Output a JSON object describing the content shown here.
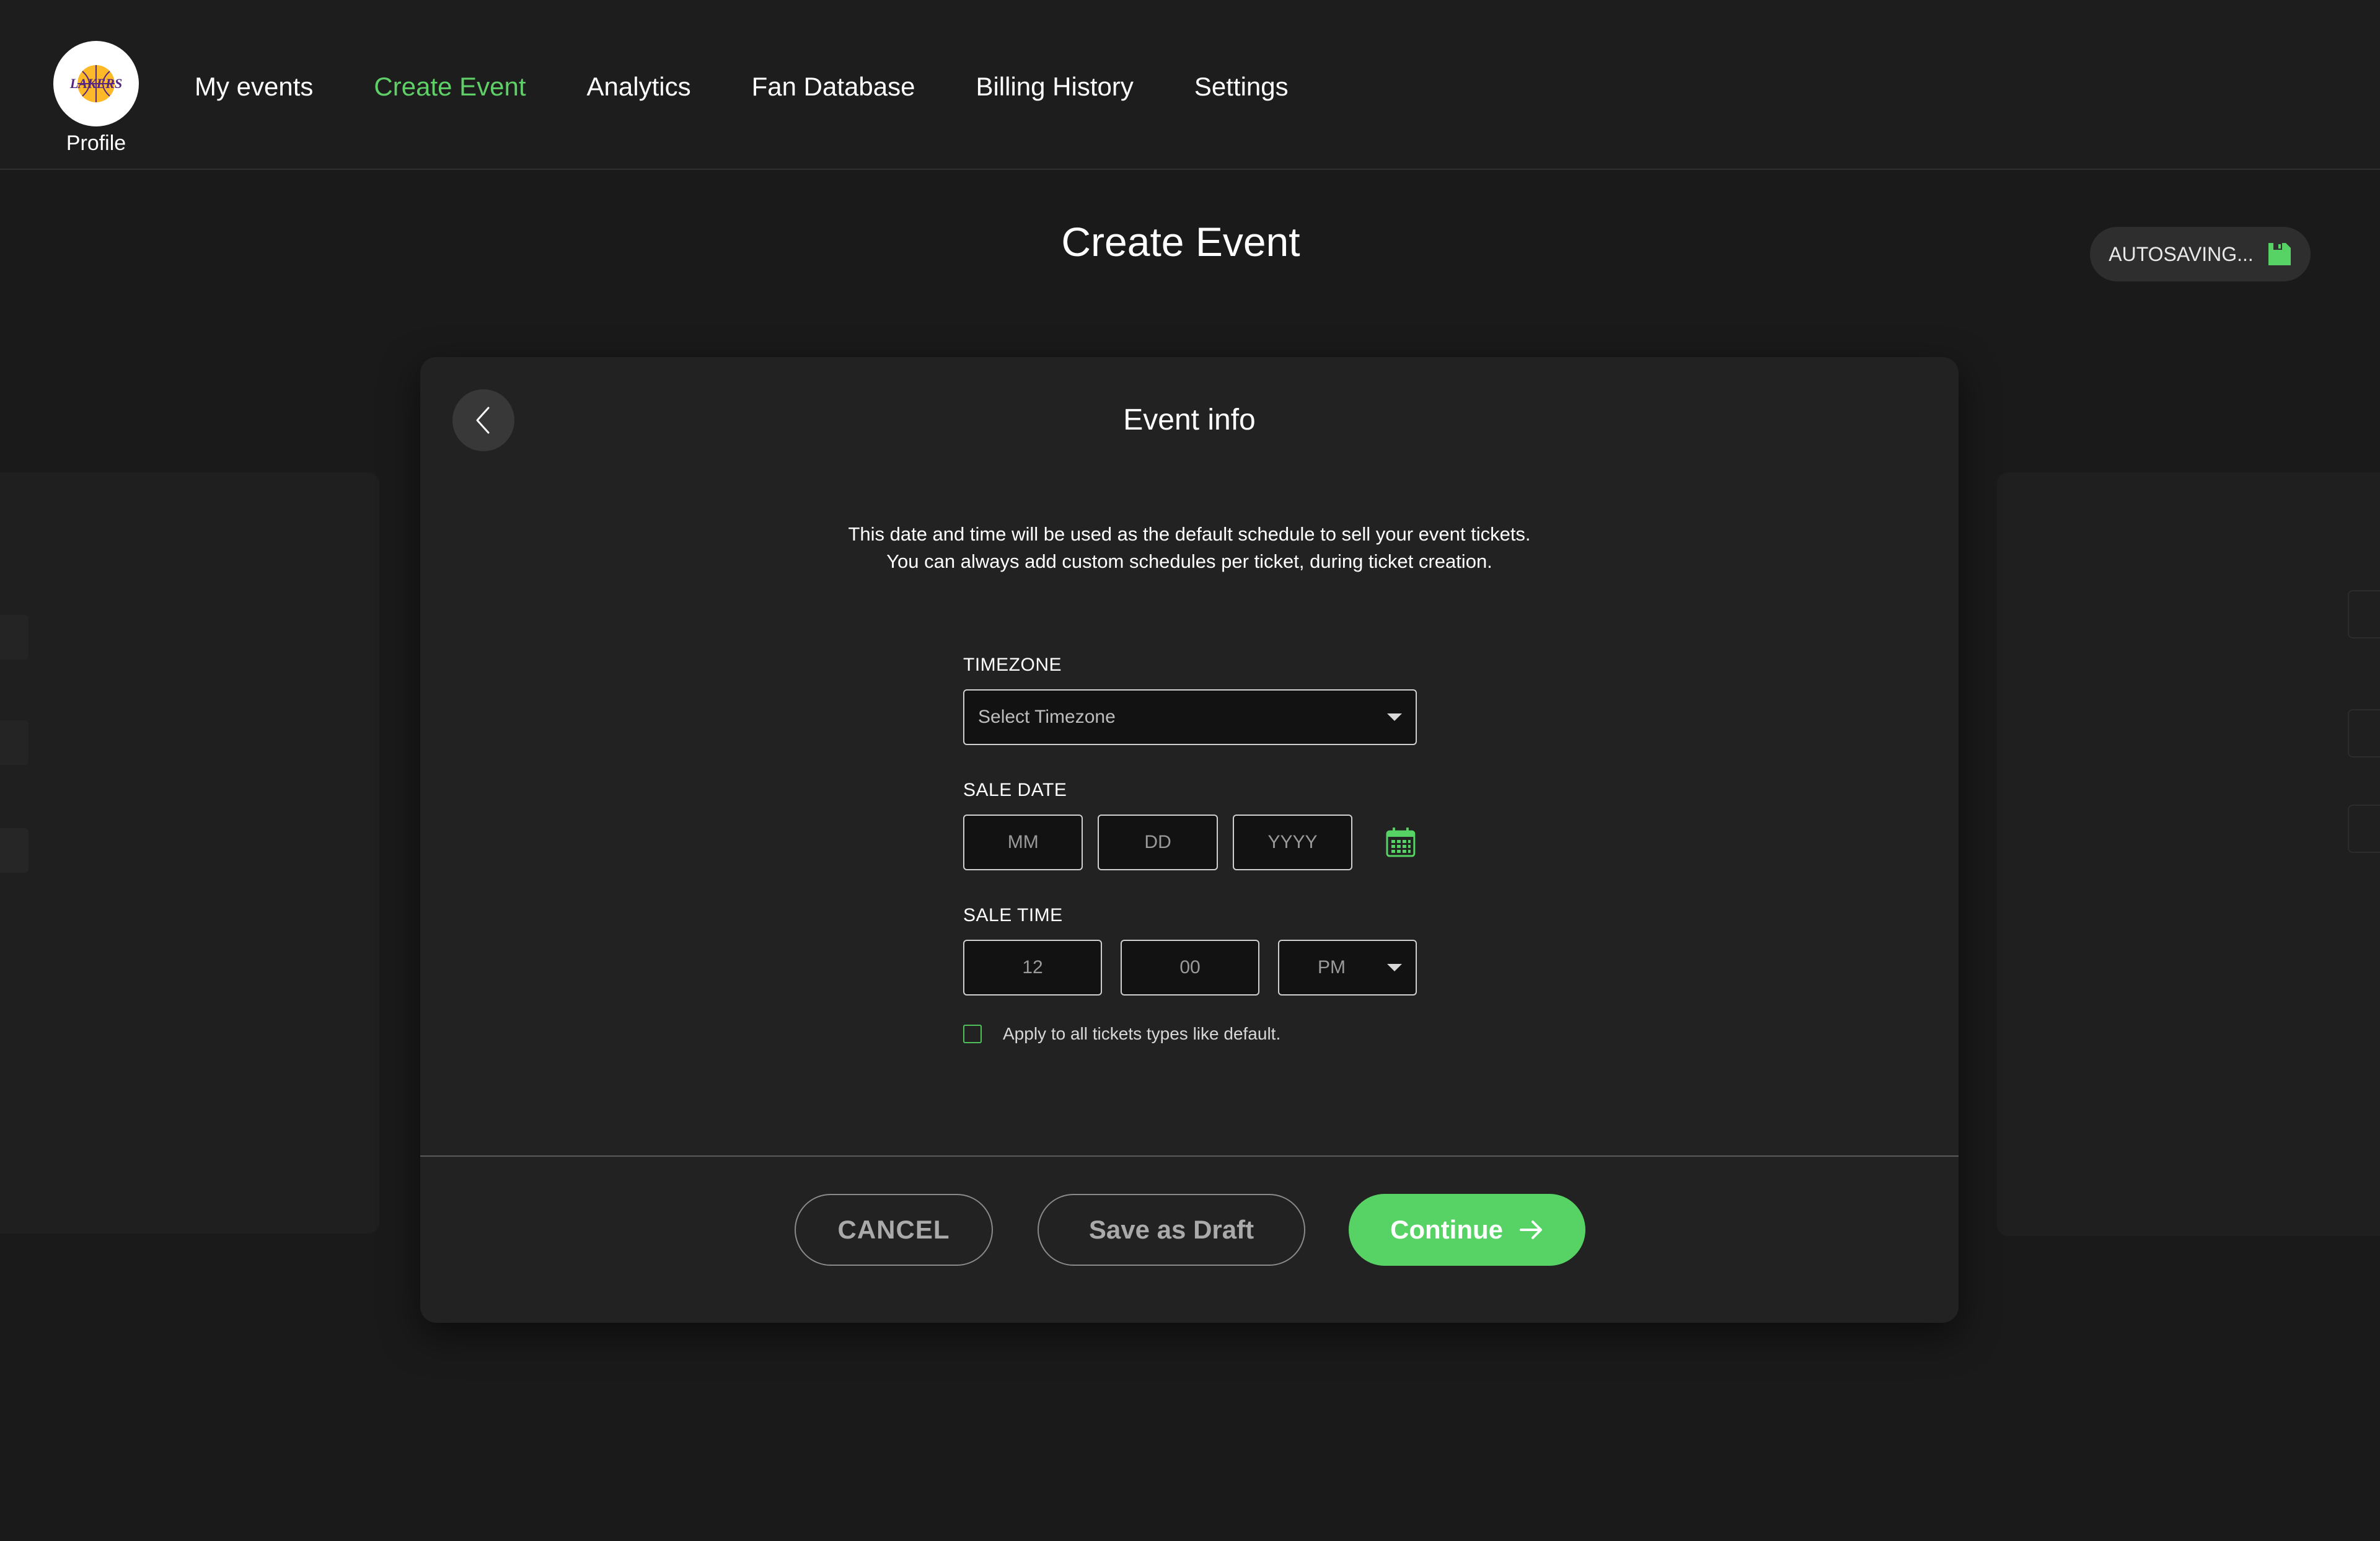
{
  "header": {
    "profile_label": "Profile",
    "logo_text": "LAKERS",
    "nav": [
      {
        "label": "My events",
        "active": false
      },
      {
        "label": "Create Event",
        "active": true
      },
      {
        "label": "Analytics",
        "active": false
      },
      {
        "label": "Fan Database",
        "active": false
      },
      {
        "label": "Billing History",
        "active": false
      },
      {
        "label": "Settings",
        "active": false
      }
    ]
  },
  "page": {
    "title": "Create Event",
    "autosave_label": "AUTOSAVING...",
    "autosave_icon": "floppy-disk-icon"
  },
  "card": {
    "title": "Event info",
    "description_line1": "This date and time will be used as the default schedule to sell your event tickets.",
    "description_line2": "You can always add custom schedules per ticket, during ticket creation.",
    "timezone": {
      "label": "TIMEZONE",
      "value": "Select Timezone"
    },
    "sale_date": {
      "label": "SALE DATE",
      "month": "MM",
      "day": "DD",
      "year": "YYYY"
    },
    "sale_time": {
      "label": "SALE TIME",
      "hour": "12",
      "minute": "00",
      "ampm": "PM"
    },
    "apply_all_label": "Apply to all tickets types like default.",
    "apply_all_checked": false,
    "buttons": {
      "cancel": "CANCEL",
      "draft": "Save as Draft",
      "continue": "Continue"
    }
  },
  "colors": {
    "accent": "#56d364",
    "background": "#1a1a1a",
    "card": "#222222",
    "logo_purple": "#552583",
    "logo_gold": "#fdb927"
  }
}
